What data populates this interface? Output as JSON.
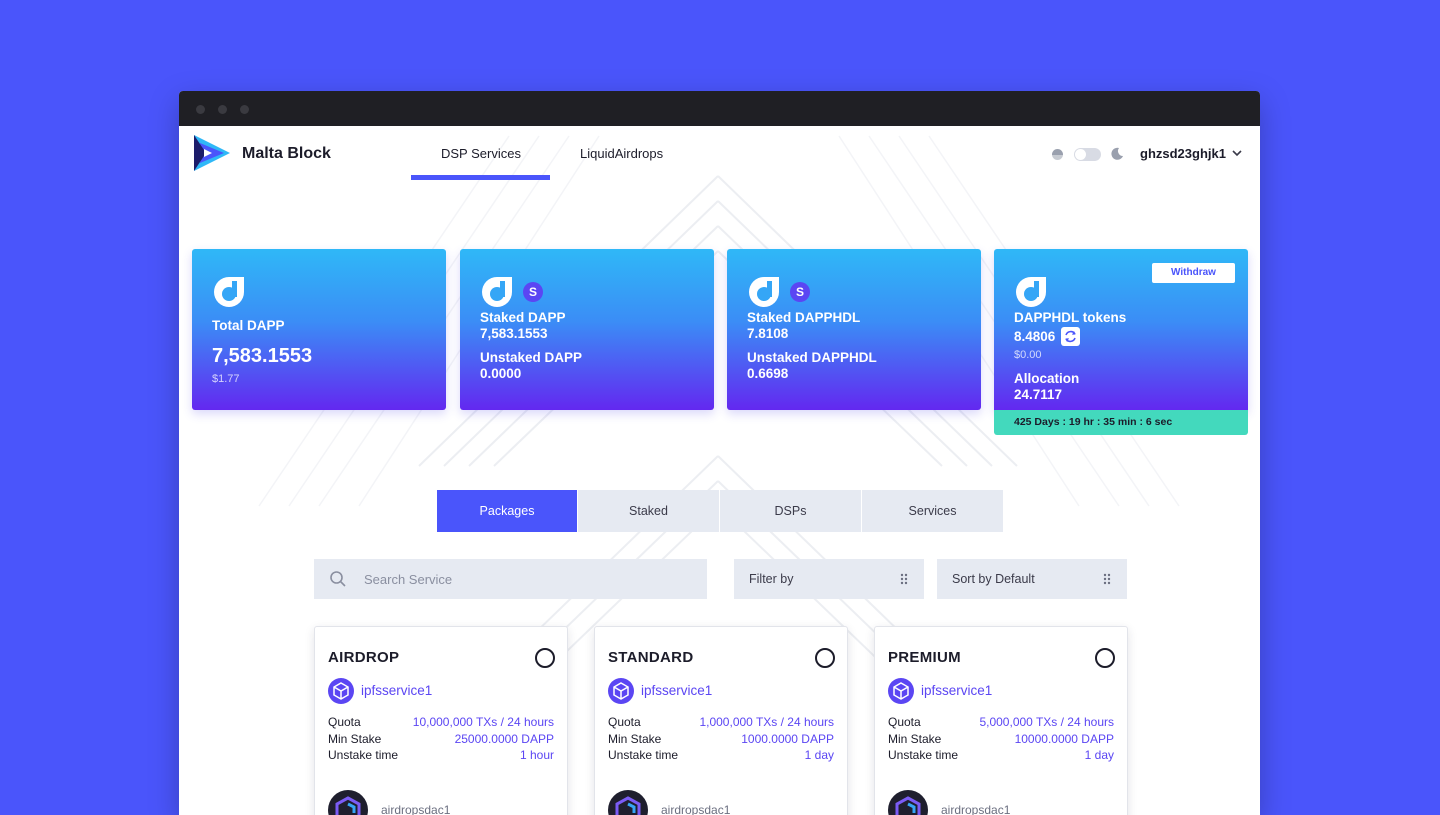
{
  "header": {
    "brand": "Malta Block",
    "nav": [
      {
        "label": "DSP Services",
        "active": true
      },
      {
        "label": "LiquidAirdrops",
        "active": false
      }
    ],
    "account": "ghzsd23ghjk1"
  },
  "stats": {
    "total": {
      "label": "Total DAPP",
      "value": "7,583.1553",
      "usd": "$1.77"
    },
    "staked_dapp": {
      "badge": "S",
      "label1": "Staked DAPP",
      "value1": "7,583.1553",
      "label2": "Unstaked DAPP",
      "value2": "0.0000"
    },
    "staked_dapphdl": {
      "badge": "S",
      "label1": "Staked DAPPHDL",
      "value1": "7.8108",
      "label2": "Unstaked DAPPHDL",
      "value2": "0.6698"
    },
    "tokens": {
      "withdraw": "Withdraw",
      "label1": "DAPPHDL tokens",
      "value1": "8.4806",
      "usd": "$0.00",
      "label2": "Allocation",
      "value2": "24.7117",
      "countdown": "425 Days : 19 hr : 35 min : 6 sec"
    }
  },
  "tabs": [
    {
      "label": "Packages",
      "active": true
    },
    {
      "label": "Staked",
      "active": false
    },
    {
      "label": "DSPs",
      "active": false
    },
    {
      "label": "Services",
      "active": false
    }
  ],
  "filters": {
    "search_placeholder": "Search Service",
    "filter_by": "Filter by",
    "sort_by": "Sort by Default"
  },
  "packages": [
    {
      "name": "AIRDROP",
      "service": "ipfsservice1",
      "quota_label": "Quota",
      "quota": "10,000,000 TXs / 24 hours",
      "stake_label": "Min Stake",
      "stake": "25000.0000 DAPP",
      "unstake_label": "Unstake time",
      "unstake": "1 hour",
      "dsp": "airdropsdac1"
    },
    {
      "name": "STANDARD",
      "service": "ipfsservice1",
      "quota_label": "Quota",
      "quota": "1,000,000 TXs / 24 hours",
      "stake_label": "Min Stake",
      "stake": "1000.0000 DAPP",
      "unstake_label": "Unstake time",
      "unstake": "1 day",
      "dsp": "airdropsdac1"
    },
    {
      "name": "PREMIUM",
      "service": "ipfsservice1",
      "quota_label": "Quota",
      "quota": "5,000,000 TXs / 24 hours",
      "stake_label": "Min Stake",
      "stake": "10000.0000 DAPP",
      "unstake_label": "Unstake time",
      "unstake": "1 day",
      "dsp": "airdropsdac1"
    }
  ],
  "colors": {
    "page_bg": "#4a55fb",
    "accent": "#4a55fb",
    "link": "#5b46f3",
    "countdown_bg": "#43d9bd"
  }
}
